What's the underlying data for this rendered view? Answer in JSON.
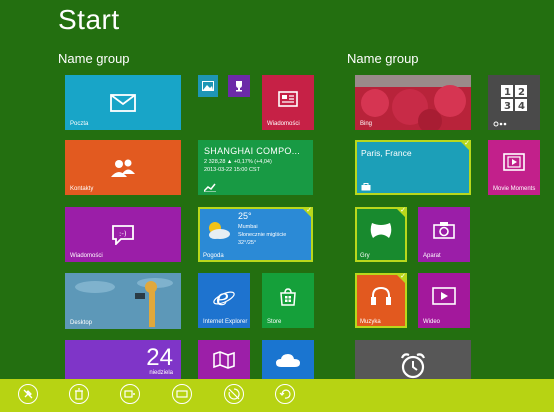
{
  "page": {
    "title": "Start"
  },
  "groups": [
    {
      "title": "Name group"
    },
    {
      "title": "Name group"
    }
  ],
  "tiles": {
    "mail": {
      "label": "Poczta"
    },
    "news": {
      "label": "Wiadomości"
    },
    "people": {
      "label": "Kontakty"
    },
    "finance": {
      "title": "SHANGHAI COMPO...",
      "line1": "2 328,28 ▲ +0,17% (+4,04)",
      "line2": "2013-03-22 15:00 CST"
    },
    "messaging": {
      "label": "Wiadomości"
    },
    "weather": {
      "temp": "25°",
      "city": "Mumbai",
      "cond": "Słonecznie miglście",
      "range": "32°/25°",
      "label": "Pogoda"
    },
    "desktop": {
      "label": "Desktop"
    },
    "ie": {
      "label": "Internet Explorer"
    },
    "store": {
      "label": "Store"
    },
    "calendar": {
      "day": "24",
      "weekday": "niedziela"
    },
    "bing": {
      "label": "Bing"
    },
    "travel": {
      "title": "Paris, France"
    },
    "movie": {
      "label": "Movie Moments"
    },
    "games": {
      "label": "Gry"
    },
    "camera": {
      "label": "Aparat"
    },
    "music": {
      "label": "Muzyka"
    },
    "video": {
      "label": "Wideo"
    }
  },
  "colors": {
    "background": "#236f10",
    "appbar": "#b7d313",
    "selection": "#b9d81c"
  }
}
